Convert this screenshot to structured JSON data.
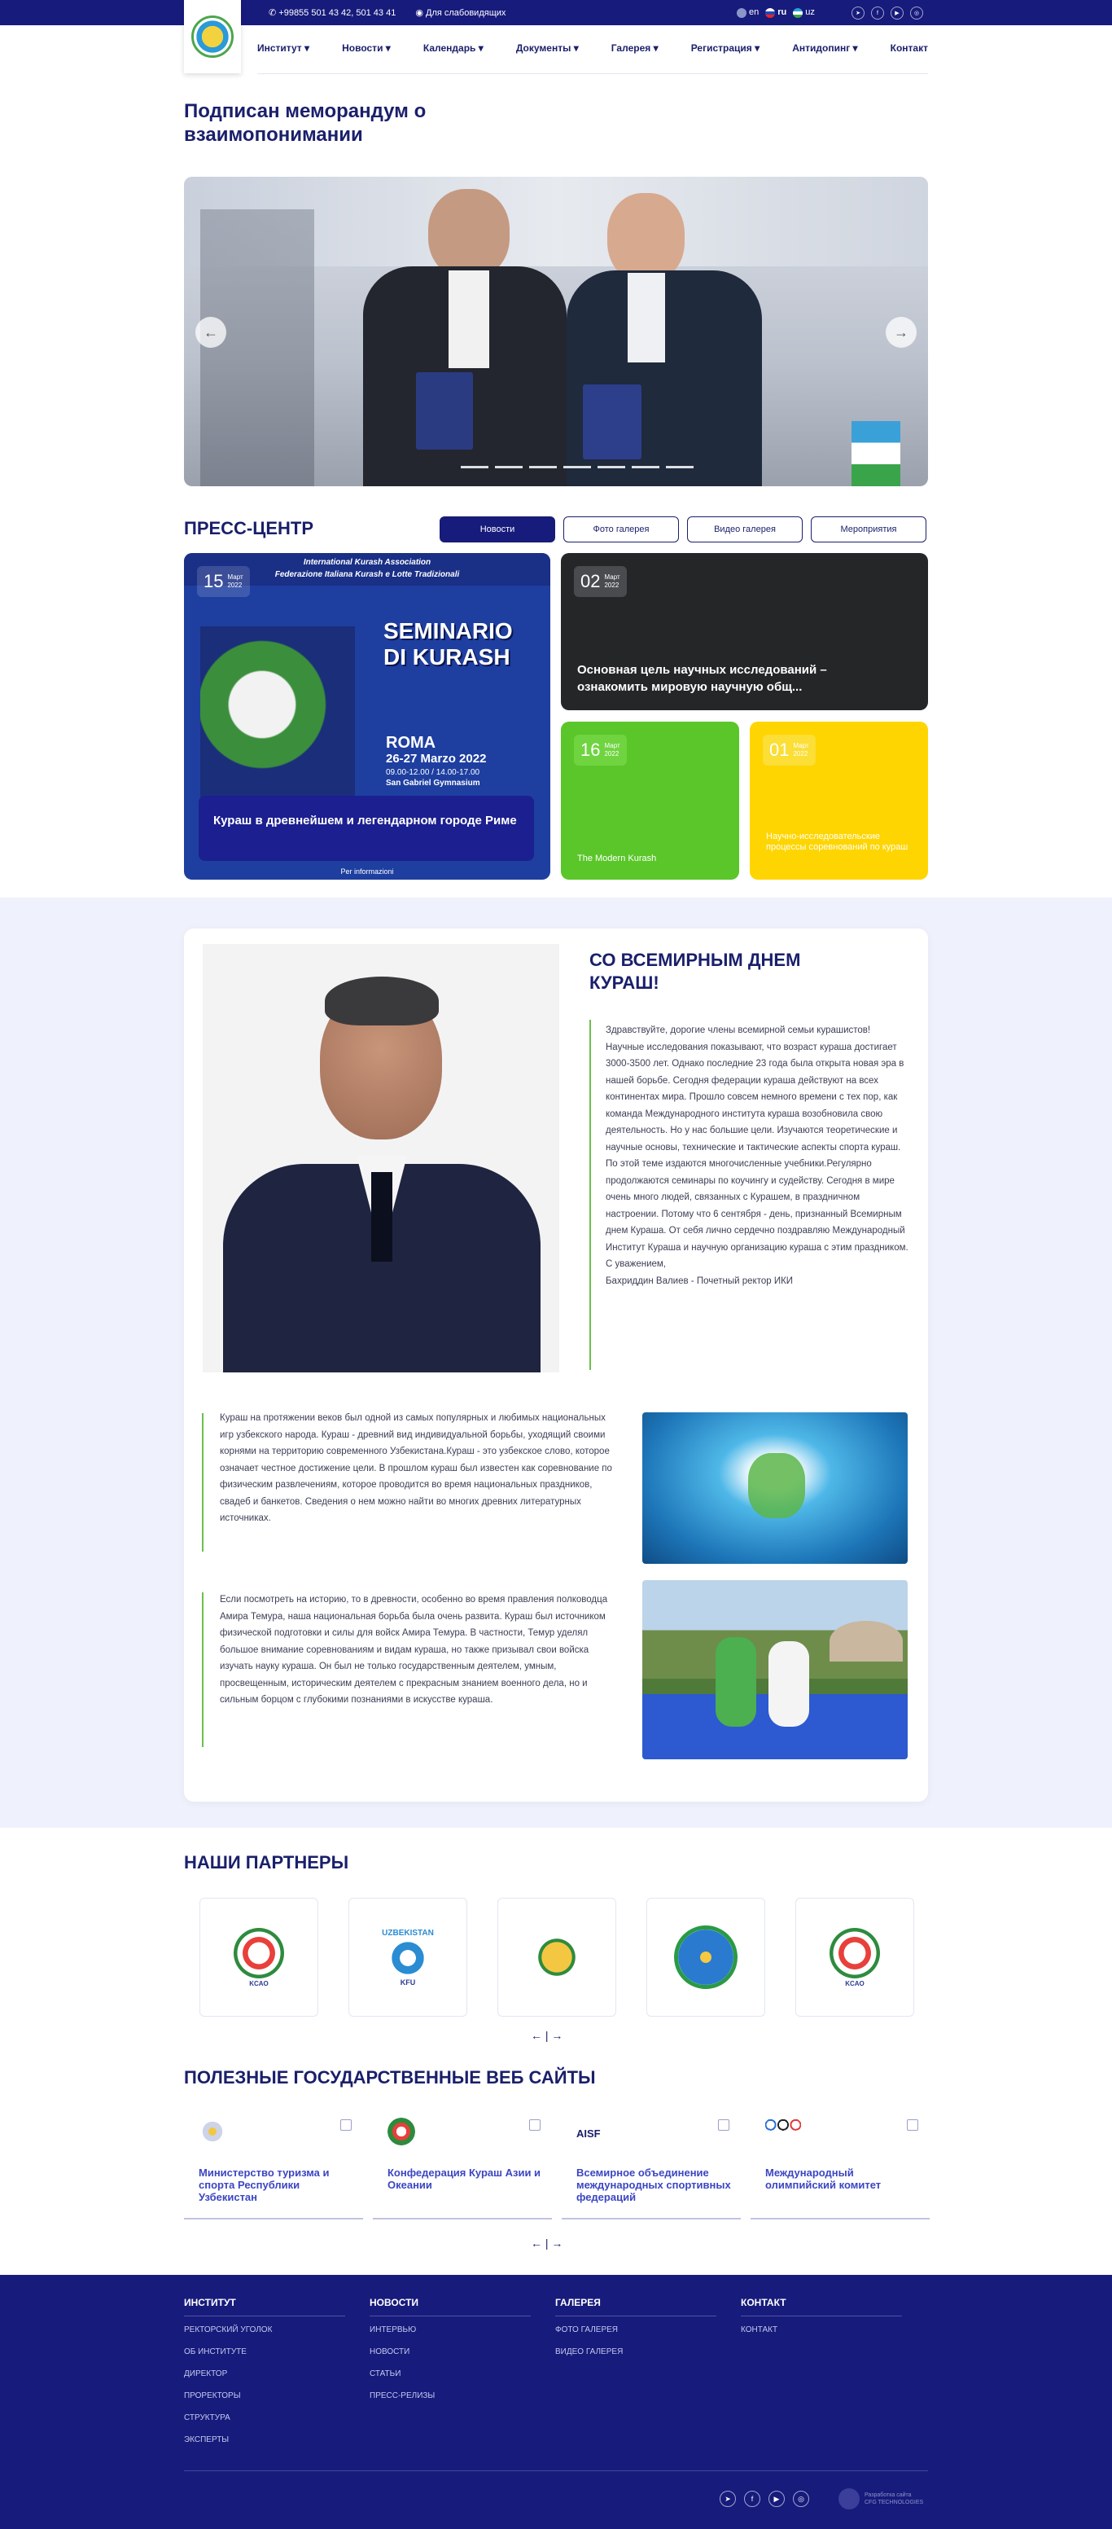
{
  "topbar": {
    "phone": "+99855 501 43 42, 501 43 41",
    "accessibility": "Для слабовидящих",
    "langs": [
      "en",
      "ru",
      "uz"
    ]
  },
  "nav": [
    "Институт",
    "Новости",
    "Календарь",
    "Документы",
    "Галерея",
    "Регистрация",
    "Антидопинг",
    "Контакт"
  ],
  "hero": {
    "title": "Подписан меморандум о взаимопонимании",
    "prev": "←",
    "next": "→",
    "slides": 7
  },
  "press": {
    "title": "ПРЕСС-ЦЕНТР",
    "tabs": [
      "Новости",
      "Фото галерея",
      "Видео галерея",
      "Мероприятия"
    ],
    "big": {
      "day": "15",
      "month": "Март",
      "year": "2022",
      "caption": "Кураш в древнейшем и легендарном городе Риме",
      "poster": {
        "org1": "International Kurash Association",
        "org2": "Federazione Italiana Kurash e Lotte Tradizionali",
        "head": "SEMINARIO DI KURASH",
        "city": "ROMA",
        "dates": "26-27 Marzo 2022",
        "hours": "09.00-12.00 / 14.00-17.00",
        "venue": "San Gabriel Gymnasium",
        "foot": "Per informazioni"
      }
    },
    "dark": {
      "day": "02",
      "month": "Март",
      "year": "2022",
      "text": "Основная цель научных исследований – ознакомить мировую научную общ..."
    },
    "green": {
      "day": "16",
      "month": "Март",
      "year": "2022",
      "text": "The Modern Kurash"
    },
    "yellow": {
      "day": "01",
      "month": "Март",
      "year": "2022",
      "text": "Научно-исследовательские процессы соревнований по кураш"
    }
  },
  "about": {
    "title": "СО ВСЕМИРНЫМ ДНЕМ КУРАШ!",
    "letter": "Здравствуйте, дорогие члены всемирной семьи курашистов!Научные исследования показывают, что возраст кураша достигает 3000-3500 лет. Однако последние 23 года была открыта новая эра в нашей борьбе. Сегодня федерации кураша действуют на всех континентах мира. Прошло совсем немного времени с тех пор, как команда Международного института кураша возобновила свою деятельность. Но у нас большие цели. Изучаются теоретические и научные основы, технические и тактические аспекты спорта кураш. По этой теме издаются многочисленные учебники.Регулярно продолжаются семинары по коучингу и судейству. Сегодня в мире очень много людей, связанных с Курашем, в праздничном настроении. Потому что 6 сентября - день, признанный Всемирным днем Кураша. От себя лично сердечно поздравляю Международный Институт Кураша и научную организацию кураша с этим праздником.",
    "regards": "С уважением,",
    "signature": "Бахриддин Валиев - Почетный ректор ИКИ",
    "p1": "Кураш на протяжении веков был одной из самых популярных и любимых национальных игр узбекского народа. Кураш - древний вид индивидуальной борьбы, уходящий своими корнями на территорию современного Узбекистана.Кураш - это узбекское слово, которое означает честное достижение цели. В прошлом кураш был известен как соревнование по физическим развлечениям, которое проводится во время национальных праздников, свадеб и банкетов. Сведения о нем можно найти во многих древних литературных источниках.",
    "p2": "Если посмотреть на историю, то в древности, особенно во время правления полководца Амира Темура, наша национальная борьба была очень развита. Кураш был источником физической подготовки и силы для войск Амира Темура. В частности, Темур уделял большое внимание соревнованиям и видам кураша, но также призывал свои войска изучать науку кураша. Он был не только государственным деятелем, умным, просвещенным, историческим деятелем с прекрасным знанием военного дела, но и сильным борцом с глубокими познаниями в искусстве кураша."
  },
  "partners": {
    "title": "НАШИ ПАРТНЕРЫ",
    "labels": [
      "KCAO",
      "UZBEKISTAN",
      "KFU",
      "",
      "",
      "KCAO"
    ],
    "pager": "←  |  →"
  },
  "sites": {
    "title": "ПОЛЕЗНЫЕ ГОСУДАРСТВЕННЫЕ ВЕБ САЙТЫ",
    "items": [
      "Министерство туризма и спорта Республики Узбекистан",
      "Конфедерация Кураш Азии и Океании",
      "Всемирное объединение международных спортивных федераций",
      "Международный олимпийский комитет"
    ],
    "aisf": "AISF",
    "pager": "←  |  →"
  },
  "footer": {
    "cols": [
      {
        "head": "ИНСТИТУТ",
        "links": [
          "РЕКТОРСКИЙ УГОЛОК",
          "ОБ ИНСТИТУТЕ",
          "ДИРЕКТОР",
          "ПРОРЕКТОРЫ",
          "СТРУКТУРА",
          "ЭКСПЕРТЫ"
        ]
      },
      {
        "head": "НОВОСТИ",
        "links": [
          "ИНТЕРВЬЮ",
          "НОВОСТИ",
          "СТАТЬИ",
          "ПРЕСС-РЕЛИЗЫ"
        ]
      },
      {
        "head": "ГАЛЕРЕЯ",
        "links": [
          "ФОТО ГАЛЕРЕЯ",
          "ВИДЕО ГАЛЕРЕЯ"
        ]
      },
      {
        "head": "КОНТАКТ",
        "links": [
          "КОНТАКТ"
        ]
      }
    ],
    "dev1": "Разработка сайта",
    "dev2": "CFG TECHNOLOGIES"
  }
}
